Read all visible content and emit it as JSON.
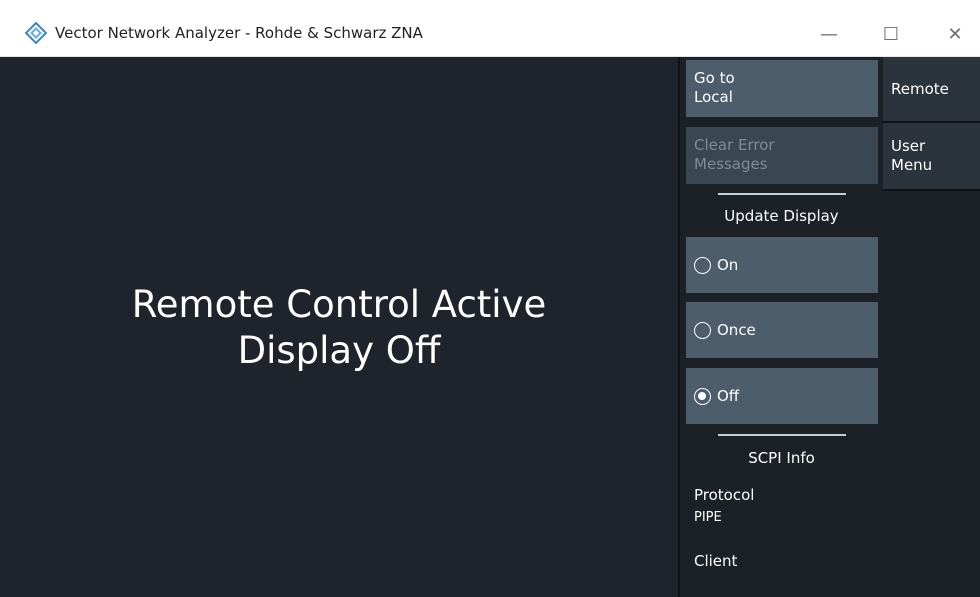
{
  "window": {
    "title": "Vector Network Analyzer - Rohde & Schwarz ZNA",
    "controls": {
      "minimize": "—",
      "maximize": "☐",
      "close": "✕"
    }
  },
  "main": {
    "line1": "Remote Control Active",
    "line2": "Display Off"
  },
  "panel": {
    "go_local_line1": "Go to",
    "go_local_line2": "Local",
    "clear_errors_line1": "Clear Error",
    "clear_errors_line2": "Messages",
    "update_display_label": "Update Display",
    "options": [
      {
        "label": "On",
        "checked": false
      },
      {
        "label": "Once",
        "checked": false
      },
      {
        "label": "Off",
        "checked": true
      }
    ],
    "scpi_info_label": "SCPI Info",
    "protocol_label": "Protocol",
    "protocol_value": "PIPE",
    "client_label": "Client"
  },
  "tabs": {
    "remote": "Remote",
    "user_menu_line1": "User",
    "user_menu_line2": "Menu"
  }
}
